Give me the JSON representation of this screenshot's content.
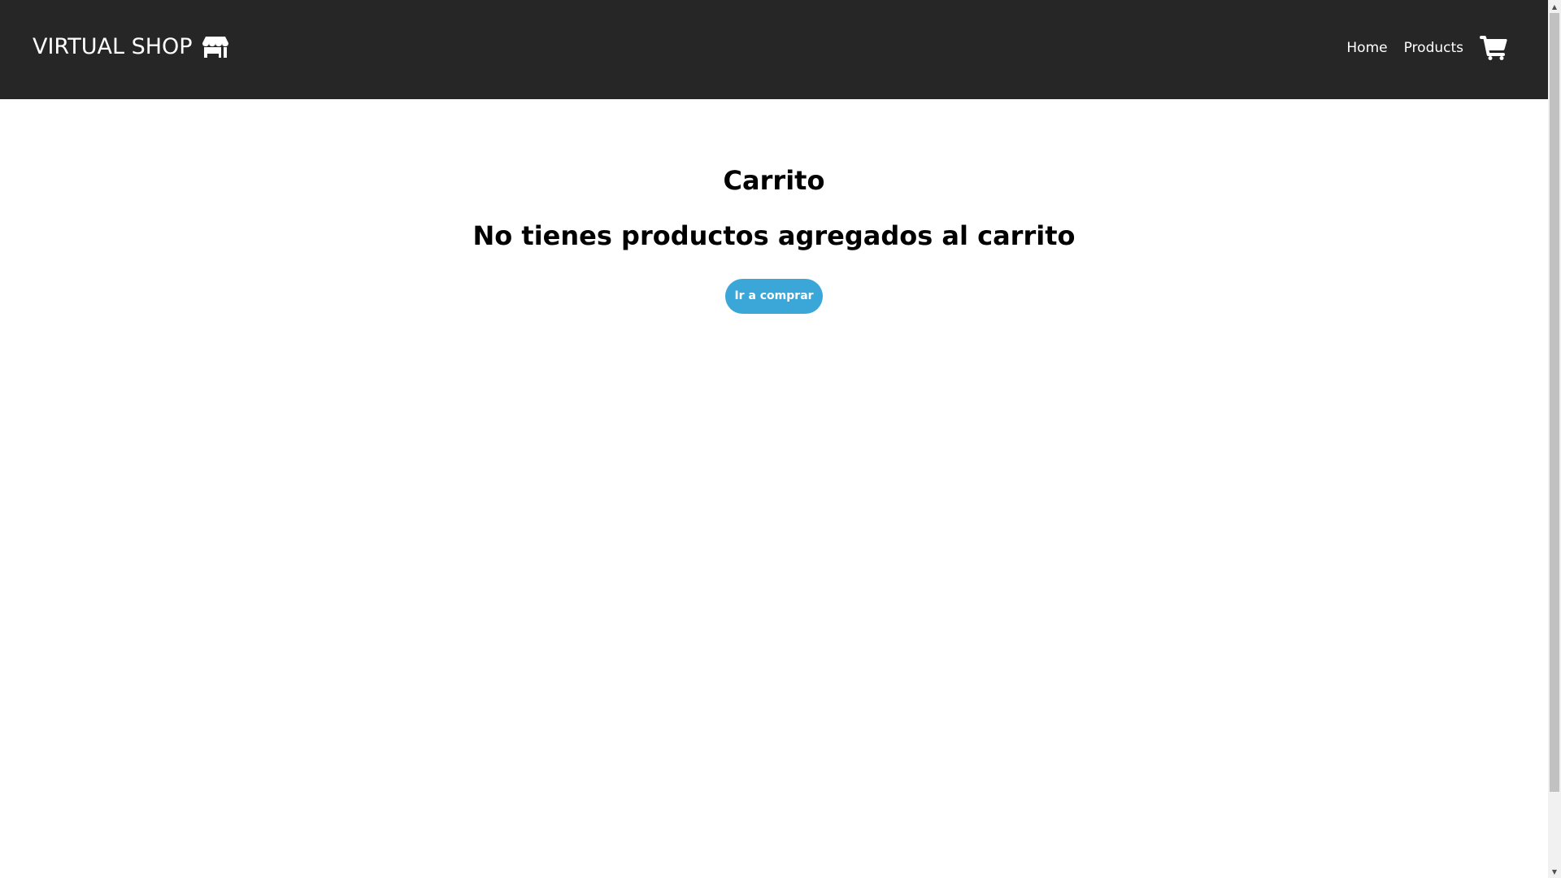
{
  "navbar": {
    "brand_label": "VIRTUAL SHOP",
    "brand_icon": "store-icon",
    "links": [
      {
        "label": "Home"
      },
      {
        "label": "Products"
      }
    ],
    "cart_icon": "cart-icon",
    "background": "#262626",
    "text_color": "#ffffff"
  },
  "main": {
    "title": "Carrito",
    "empty_message": "No tienes productos agregados al carrito",
    "shop_button_label": "Ir a comprar",
    "button_color": "#3aa7d8"
  },
  "scrollbar": {
    "up_arrow": "▲",
    "down_arrow": "▼"
  }
}
